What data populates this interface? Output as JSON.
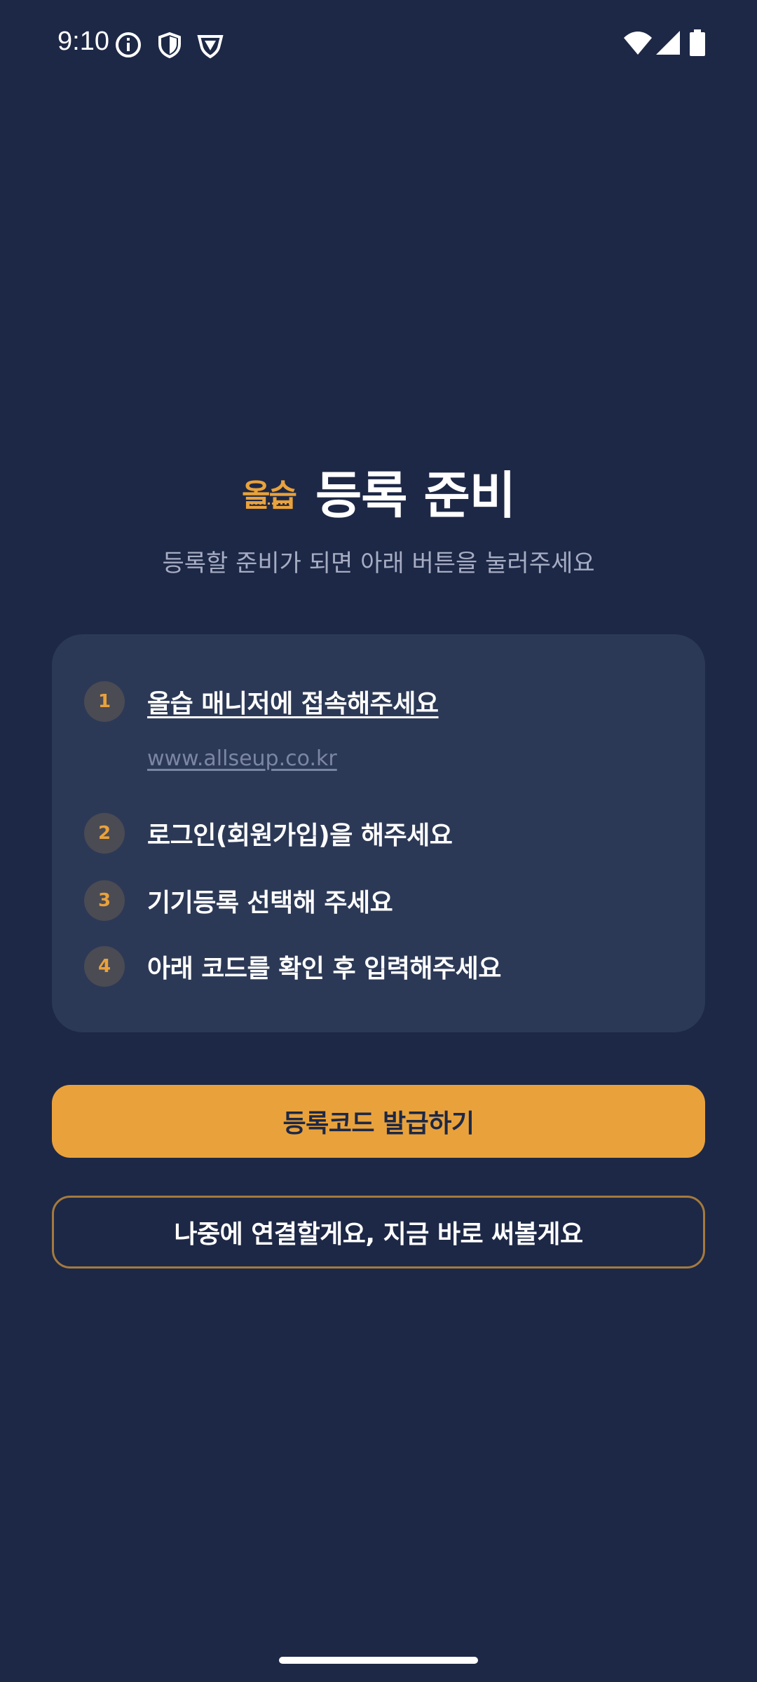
{
  "status_bar": {
    "time": "9:10",
    "icons_left": [
      "info-icon",
      "shield-icon",
      "vpn-shield-icon"
    ],
    "icons_right": [
      "wifi-icon",
      "cell-signal-icon",
      "battery-icon"
    ]
  },
  "header": {
    "logo_text": "올습",
    "title": "등록 준비",
    "subtitle": "등록할 준비가 되면 아래 버튼을 눌러주세요"
  },
  "steps": [
    {
      "number": "1",
      "text": "올습 매니저에 접속해주세요",
      "url": "www.allseup.co.kr"
    },
    {
      "number": "2",
      "text": "로그인(회원가입)을 해주세요"
    },
    {
      "number": "3",
      "text": "기기등록 선택해 주세요"
    },
    {
      "number": "4",
      "text": "아래 코드를 확인 후 입력해주세요"
    }
  ],
  "buttons": {
    "issue_code": "등록코드 발급하기",
    "later": "나중에 연결할게요, 지금 바로 써볼게요"
  },
  "colors": {
    "background": "#1d2846",
    "card": "#2c3956",
    "accent": "#e9a23b"
  }
}
